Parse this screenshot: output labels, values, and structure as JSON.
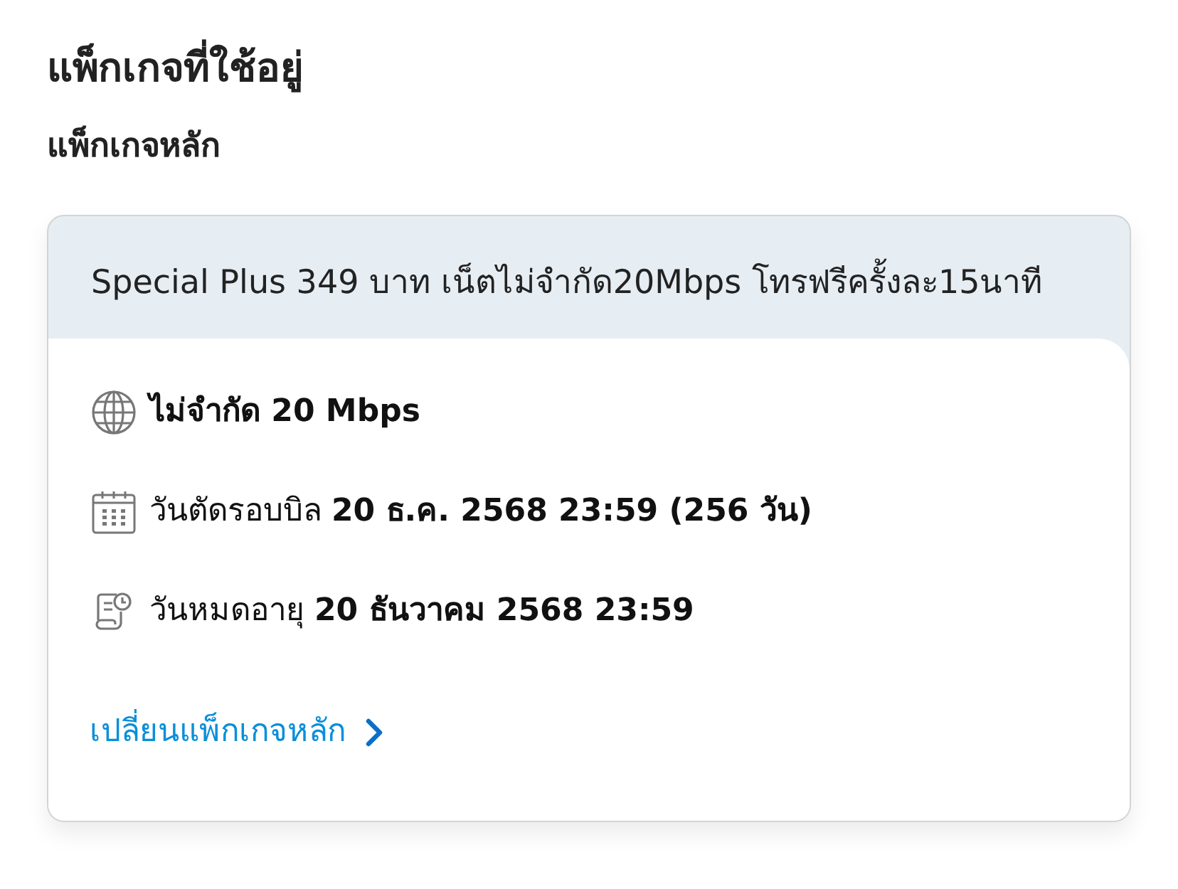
{
  "page": {
    "title": "แพ็กเกจที่ใช้อยู่",
    "subtitle": "แพ็กเกจหลัก"
  },
  "package_card": {
    "name": "Special Plus 349 บาท เน็ตไม่จำกัด20Mbps โทรฟรีครั้งละ15นาที",
    "details": [
      {
        "kind": "globe",
        "bold": true,
        "text": "ไม่จำกัด 20 Mbps"
      },
      {
        "kind": "calendar",
        "bold": false,
        "text": "วันตัดรอบบิล **20 ธ.ค. 2568 23:59 (256 วัน)**"
      },
      {
        "kind": "expiry",
        "bold": false,
        "text": "วันหมดอายุ **20 ธันวาคม 2568 23:59**"
      }
    ],
    "link": {
      "label": "เปลี่ยนแพ็กเกจหลัก"
    }
  }
}
